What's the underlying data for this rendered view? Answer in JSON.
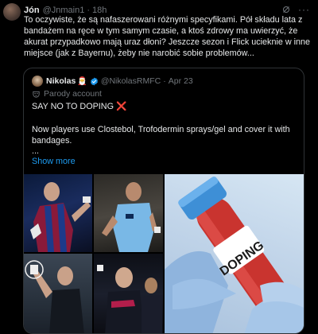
{
  "tweet": {
    "name": "Jón",
    "handle": "@Jnmain1",
    "dot": "·",
    "time": "18h",
    "more": "···",
    "text": "To oczywiste, że są nafaszerowani różnymi specyfikami. Pół składu lata z bandażem na ręce w tym samym czasie, a ktoś zdrowy ma uwierzyć, że akurat przypadkowo mają uraz dłoni? Jeszcze sezon i Flick ucieknie w inne miejsce (jak z Bayernu), żeby nie narobić sobie problemów..."
  },
  "quote": {
    "name": "Nikolas",
    "emoji": "🎅",
    "handle": "@NikolasRMFC",
    "dot": "·",
    "date": "Apr 23",
    "parody_label": "Parody account",
    "line1": "SAY NO TO DOPING",
    "x_mark": "❌",
    "line2": "Now players use Clostebol, Trofodermin sprays/gel and cover it with bandages.",
    "ellipsis": "...",
    "show_more": "Show more"
  },
  "media": {
    "vial_label": "DOPING"
  },
  "colors": {
    "background": "#000000",
    "text": "#e7e9ea",
    "muted": "#71767b",
    "link": "#1d9bf0",
    "verified": "#1d9bf0",
    "red_x": "#f4212e"
  }
}
